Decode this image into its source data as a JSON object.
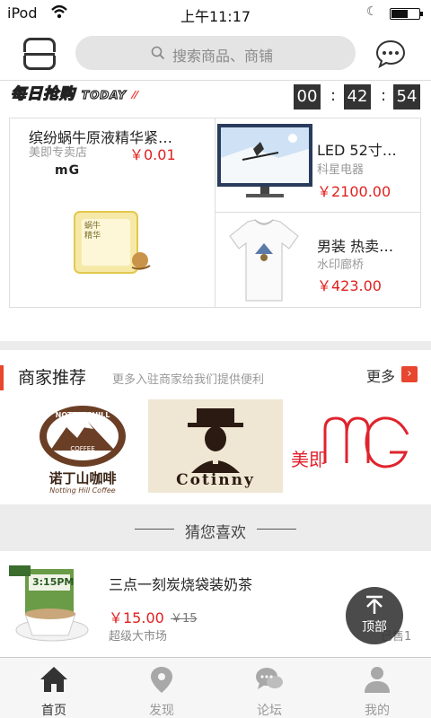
{
  "status_bar": {
    "carrier": "iPod",
    "time": "上午11:17"
  },
  "header": {
    "search_placeholder": "搜索商品、商铺"
  },
  "daily_deals": {
    "title": "每日抢购",
    "title_suffix": "TODAY",
    "countdown": {
      "hours": "00",
      "minutes": "42",
      "seconds": "54",
      "separator": ":"
    },
    "products": [
      {
        "title": "缤纷蜗牛原液精华紧…",
        "shop": "美即专卖店",
        "price": "￥0.01",
        "logo_text": "mG",
        "image_caption": "蜗牛精华"
      },
      {
        "title": "LED 52寸…",
        "shop": "科星电器",
        "price": "￥2100.00"
      },
      {
        "title": "男装 热卖…",
        "shop": "水印廊桥",
        "price": "￥423.00"
      }
    ]
  },
  "merchants": {
    "title": "商家推荐",
    "subtitle": "更多入驻商家给我们提供便利",
    "more_label": "更多",
    "logos": [
      {
        "top_text": "NOTTINGHILL",
        "coffee_text": "COFFEE",
        "name": "诺丁山咖啡",
        "tagline": "Notting Hill Coffee"
      },
      {
        "name": "Cotinny"
      },
      {
        "name": "美即",
        "mark": "mG"
      }
    ]
  },
  "guess": {
    "title": "猜您喜欢"
  },
  "recommend_item": {
    "title": "三点一刻炭烧袋装奶茶",
    "price": "￥15.00",
    "old_price": "￥15",
    "shop": "超级大市场",
    "sold": "已售1",
    "package_text": "3:15PM"
  },
  "back_to_top": {
    "label": "顶部"
  },
  "tabs": [
    {
      "label": "首页",
      "icon": "home-icon",
      "active": true
    },
    {
      "label": "发现",
      "icon": "location-icon",
      "active": false
    },
    {
      "label": "论坛",
      "icon": "chat-bubbles-icon",
      "active": false
    },
    {
      "label": "我的",
      "icon": "person-icon",
      "active": false
    }
  ],
  "colors": {
    "price": "#e02020",
    "accent": "#e8462e",
    "countdown_bg": "#333333"
  }
}
